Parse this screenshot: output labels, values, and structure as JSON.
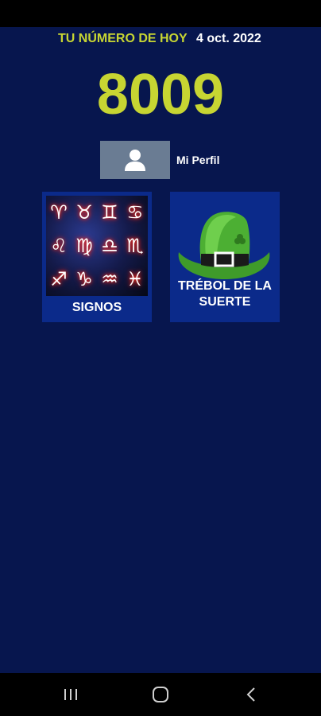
{
  "header": {
    "label": "TU NÚMERO DE HOY",
    "date": "4 oct. 2022"
  },
  "daily_number": "8009",
  "profile": {
    "icon": "person-icon",
    "label": "Mi Perfil"
  },
  "tiles": [
    {
      "label": "SIGNOS",
      "icon": "zodiac-signs-icon"
    },
    {
      "label": "TRÉBOL DE LA SUERTE",
      "label_lines": [
        "TRÉBOL DE LA",
        "SUERTE"
      ],
      "icon": "leprechaun-hat-icon"
    }
  ],
  "zodiac_glyphs": [
    "♈",
    "♉",
    "♊",
    "♋",
    "♌",
    "♍",
    "♎",
    "♏",
    "♐",
    "♑",
    "♒",
    "♓"
  ],
  "nav": {
    "recents_icon": "recents-icon",
    "home_icon": "home-icon",
    "back_icon": "back-icon"
  },
  "colors": {
    "background": "#07164e",
    "accent": "#c7d532",
    "tile": "#0b2a8a",
    "profile_button": "#6a7c93"
  }
}
